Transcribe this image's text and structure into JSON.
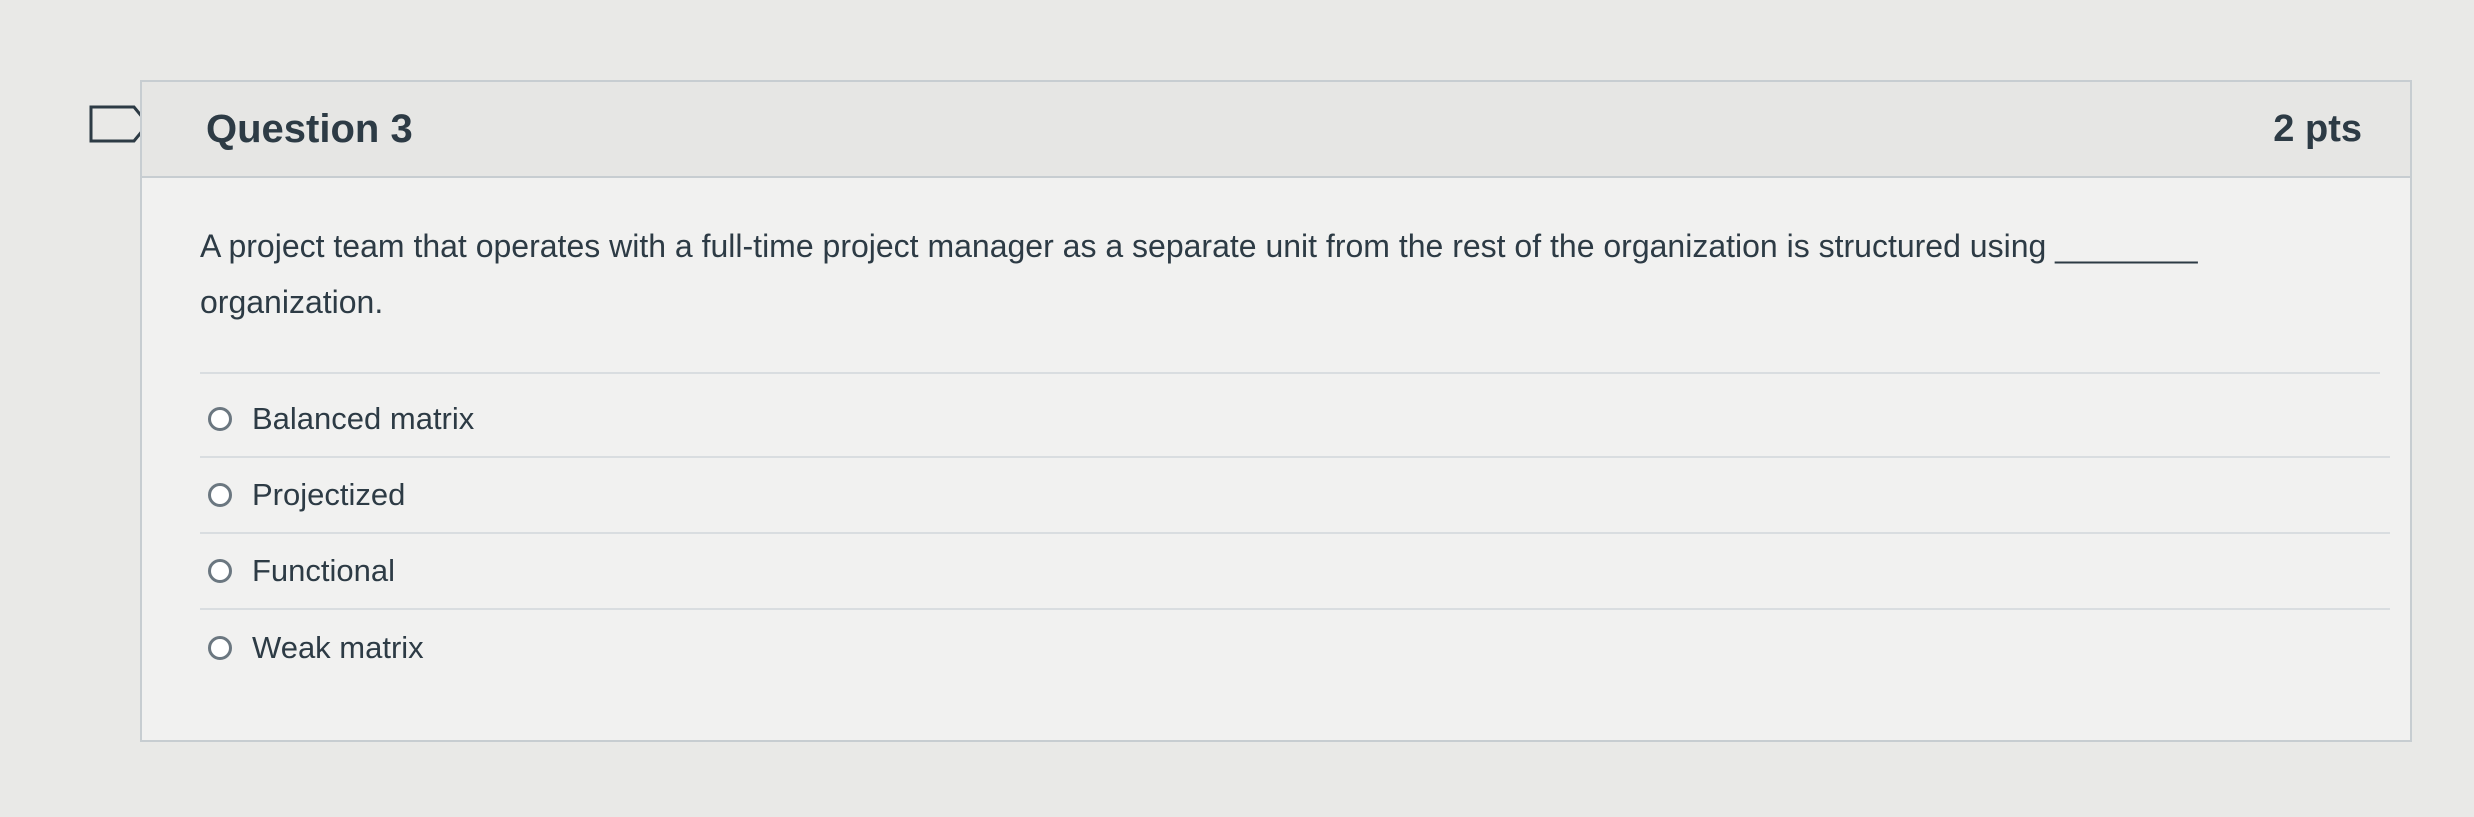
{
  "question": {
    "title": "Question 3",
    "points": "2 pts",
    "text": "A project team that operates with a full-time project manager as a separate unit from the rest of the organization is structured using ________ organization.",
    "bookmark_icon": "bookmark-flag-icon"
  },
  "answers": [
    {
      "label": "Balanced matrix"
    },
    {
      "label": "Projectized"
    },
    {
      "label": "Functional"
    },
    {
      "label": "Weak matrix"
    }
  ],
  "colors": {
    "text": "#2d3b45",
    "header_bg": "#e6e6e4",
    "card_bg": "#f1f1f0",
    "border": "#c7cdd1",
    "page_bg": "#e9e9e7"
  }
}
